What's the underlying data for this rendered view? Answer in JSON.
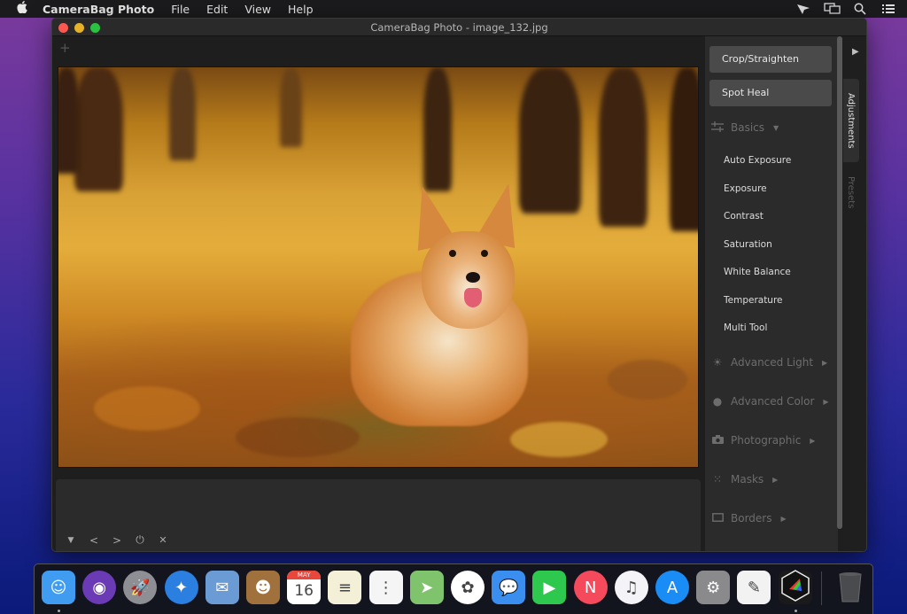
{
  "menubar": {
    "apple_icon": "apple-icon",
    "app_name": "CameraBag Photo",
    "menus": [
      "File",
      "Edit",
      "View",
      "Help"
    ],
    "status_icons": [
      "location-arrow-icon",
      "display-mirroring-icon",
      "search-icon",
      "control-list-icon"
    ]
  },
  "window": {
    "title": "CameraBag Photo - image_132.jpg",
    "add_label": "+",
    "photo_name": "image_132.jpg"
  },
  "filmstrip": {
    "controls": [
      {
        "name": "collapse-triangle-icon",
        "glyph": "▼"
      },
      {
        "name": "previous-icon",
        "glyph": "<"
      },
      {
        "name": "next-icon",
        "glyph": ">"
      },
      {
        "name": "power-icon",
        "glyph": "⏻"
      },
      {
        "name": "close-icon",
        "glyph": "✕"
      }
    ]
  },
  "panel": {
    "buttons": [
      "Crop/Straighten",
      "Spot Heal"
    ],
    "basics": {
      "label": "Basics",
      "items": [
        "Auto Exposure",
        "Exposure",
        "Contrast",
        "Saturation",
        "White Balance",
        "Temperature",
        "Multi Tool"
      ]
    },
    "sections": [
      {
        "label": "Advanced Light",
        "icon": "sun-icon",
        "glyph": "☀"
      },
      {
        "label": "Advanced Color",
        "icon": "color-drops-icon",
        "glyph": "●"
      },
      {
        "label": "Photographic",
        "icon": "camera-icon",
        "glyph": "◙"
      },
      {
        "label": "Masks",
        "icon": "mask-pattern-icon",
        "glyph": "⁙"
      },
      {
        "label": "Borders",
        "icon": "border-rectangle-icon",
        "glyph": "▭"
      }
    ],
    "tabs": [
      "Adjustments",
      "Presets"
    ],
    "active_tab": "Adjustments"
  },
  "dock": {
    "items": [
      {
        "name": "Finder",
        "color": "#3f9cf0",
        "glyph": "☺",
        "running": true
      },
      {
        "name": "Siri",
        "color": "#6a3bb5",
        "glyph": "◉",
        "running": false
      },
      {
        "name": "Launchpad",
        "color": "#8d8f94",
        "glyph": "🚀",
        "running": false
      },
      {
        "name": "Safari",
        "color": "#2b7fe0",
        "glyph": "✦",
        "running": false
      },
      {
        "name": "Mail",
        "color": "#6a9bd5",
        "glyph": "✉",
        "running": false
      },
      {
        "name": "Contacts",
        "color": "#a0713d",
        "glyph": "☻",
        "running": false
      },
      {
        "name": "Calendar",
        "color": "#ffffff",
        "glyph": "16",
        "running": false
      },
      {
        "name": "Notes",
        "color": "#f4f0d8",
        "glyph": "≡",
        "running": false
      },
      {
        "name": "Reminders",
        "color": "#f5f5f5",
        "glyph": "⋮",
        "running": false
      },
      {
        "name": "Maps",
        "color": "#7fc46c",
        "glyph": "➤",
        "running": false
      },
      {
        "name": "Photos",
        "color": "#ffffff",
        "glyph": "✿",
        "running": false
      },
      {
        "name": "Messages",
        "color": "#3a8ef0",
        "glyph": "💬",
        "running": false
      },
      {
        "name": "FaceTime",
        "color": "#2dc84d",
        "glyph": "▶",
        "running": false
      },
      {
        "name": "News",
        "color": "#f44a5c",
        "glyph": "N",
        "running": false
      },
      {
        "name": "iTunes",
        "color": "#f4f4f8",
        "glyph": "♫",
        "running": false
      },
      {
        "name": "App Store",
        "color": "#1a8cf5",
        "glyph": "A",
        "running": false
      },
      {
        "name": "System Preferences",
        "color": "#8a8a8c",
        "glyph": "⚙",
        "running": false
      },
      {
        "name": "TextEdit",
        "color": "#f2f2f2",
        "glyph": "✎",
        "running": false
      },
      {
        "name": "CameraBag Photo",
        "color": "#1a1a1a",
        "glyph": "◆",
        "running": true
      }
    ],
    "calendar_month": "MAY",
    "calendar_day": "16",
    "trash": {
      "name": "Trash",
      "glyph": "🗑"
    }
  }
}
